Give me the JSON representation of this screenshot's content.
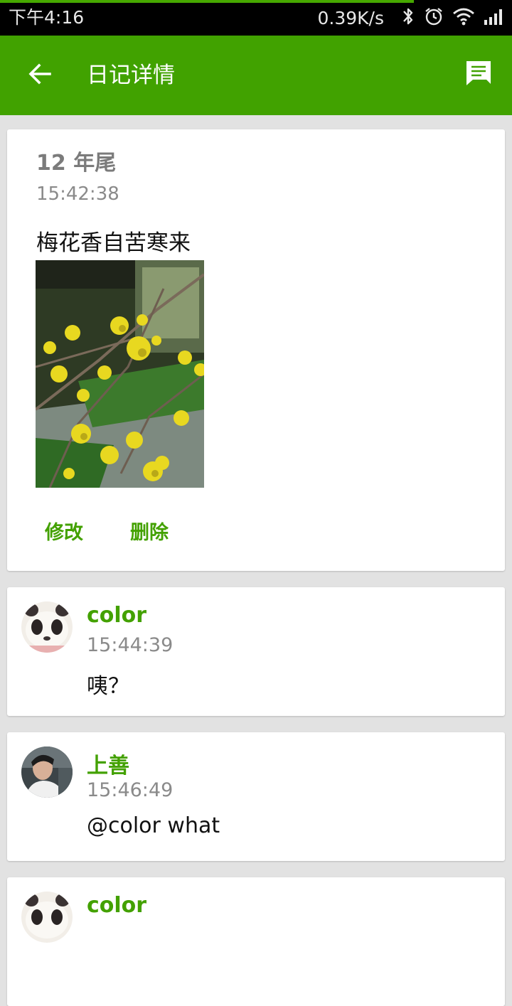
{
  "status_bar": {
    "time": "下午4:16",
    "net_speed": "0.39K/s",
    "icons": [
      "bluetooth-icon",
      "alarm-icon",
      "wifi-icon",
      "signal-icon"
    ]
  },
  "app_bar": {
    "title": "日记详情",
    "back_icon": "arrow-left-icon",
    "action_icon": "comment-icon",
    "color": "#41a200"
  },
  "diary": {
    "title": "12 年尾",
    "time": "15:42:38",
    "content": "梅花香自苦寒来",
    "edit_label": "修改",
    "delete_label": "删除"
  },
  "comments": [
    {
      "user": "color",
      "time": "15:44:39",
      "text": "咦？"
    },
    {
      "user": "上善",
      "time": "15:46:49",
      "text": "@color what"
    },
    {
      "user": "color"
    }
  ],
  "colors": {
    "accent": "#43a100",
    "background": "#e2e2e2"
  }
}
